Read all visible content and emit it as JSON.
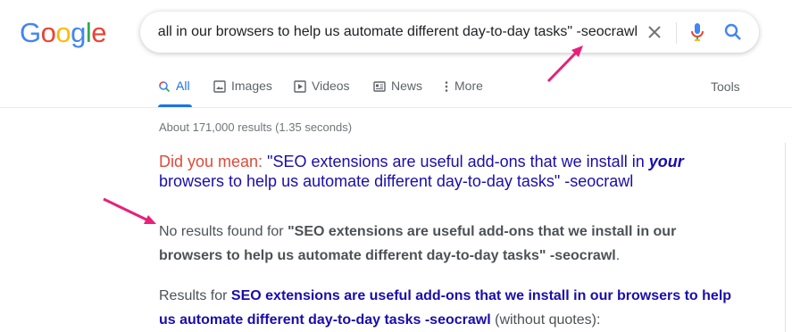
{
  "logo": {
    "text": "Google",
    "letters": [
      "G",
      "o",
      "o",
      "g",
      "l",
      "e"
    ],
    "colors": [
      "#4285F4",
      "#EA4335",
      "#FBBC05",
      "#4285F4",
      "#34A853",
      "#EA4335"
    ]
  },
  "search": {
    "query_visible": "all in our browsers to help us automate different day-to-day tasks\" -seocrawl"
  },
  "icons": {
    "clear": "close-icon",
    "mic": "mic-icon",
    "search": "search-icon"
  },
  "tabs": [
    {
      "label": "All",
      "icon": "search-icon",
      "active": true
    },
    {
      "label": "Images",
      "icon": "image-icon",
      "active": false
    },
    {
      "label": "Videos",
      "icon": "play-icon",
      "active": false
    },
    {
      "label": "News",
      "icon": "news-icon",
      "active": false
    },
    {
      "label": "More",
      "icon": "more-vert-icon",
      "active": false
    }
  ],
  "tools_label": "Tools",
  "stats": "About 171,000 results (1.35 seconds)",
  "did_you_mean": {
    "lead": "Did you mean:",
    "part1": "\"SEO extensions are useful add-ons that we install in",
    "emphasis": "your",
    "part2": "browsers to help us automate different day-to-day tasks\" -seocrawl"
  },
  "no_results": {
    "lead": "No results found for",
    "query": "\"SEO extensions are useful add-ons that we install in our browsers to help us automate different day-to-day tasks\" -seocrawl",
    "end": "."
  },
  "results_for": {
    "lead": "Results for",
    "query": "SEO extensions are useful add-ons that we install in our browsers to help us automate different day-to-day tasks -seocrawl",
    "trail": "(without quotes):"
  },
  "colors": {
    "link": "#1a0dab",
    "did_you_mean": "#dd4b39",
    "active_tab": "#1a73e8",
    "annotation_arrow": "#e8207a"
  }
}
